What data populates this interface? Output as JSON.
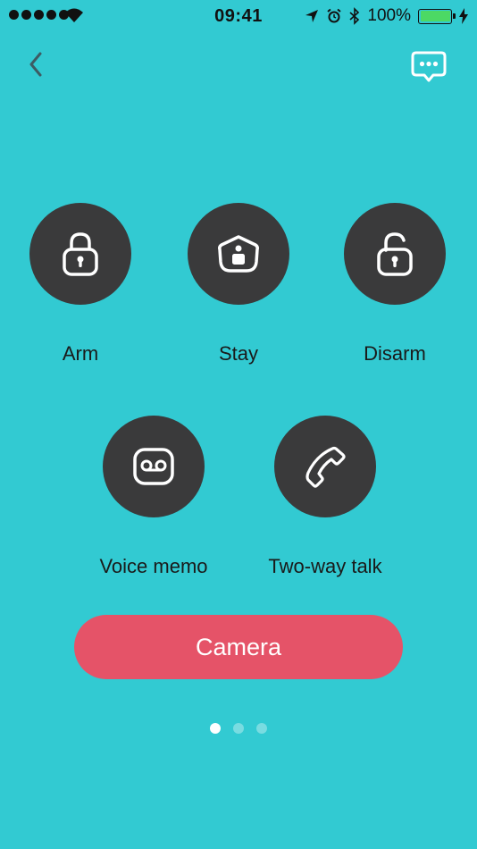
{
  "status_bar": {
    "time": "09:41",
    "battery_percent": "100%"
  },
  "nav": {
    "back_icon": "chevron-left-icon",
    "chat_icon": "chat-bubble-icon"
  },
  "actions": [
    {
      "label": "Arm",
      "icon": "lock-closed-icon"
    },
    {
      "label": "Stay",
      "icon": "home-lock-icon"
    },
    {
      "label": "Disarm",
      "icon": "lock-open-icon"
    },
    {
      "label": "Voice memo",
      "icon": "voicemail-icon"
    },
    {
      "label": "Two-way talk",
      "icon": "phone-icon"
    }
  ],
  "camera_button": {
    "label": "Camera"
  },
  "pager": {
    "total_pages": 3,
    "current_page": 1
  },
  "colors": {
    "background": "#32CAD2",
    "action_circle": "#3A3A3B",
    "camera_button": "#E55368",
    "battery_fill": "#4CD964"
  }
}
